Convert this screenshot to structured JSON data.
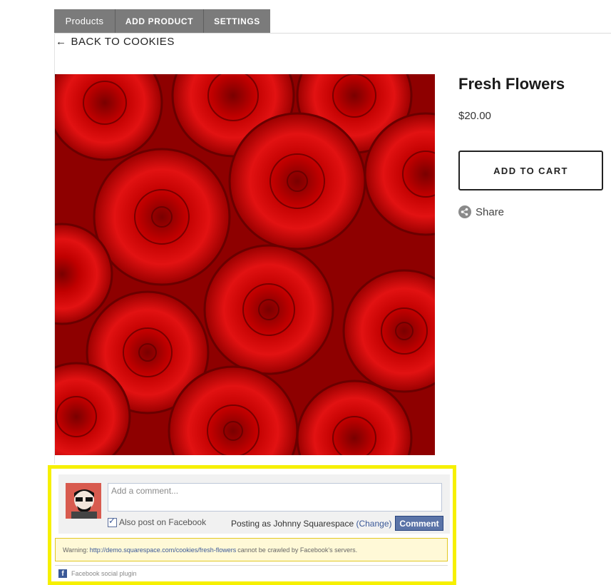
{
  "admin_tabs": [
    "Products",
    "ADD PRODUCT",
    "SETTINGS"
  ],
  "back_link": {
    "arrow": "←",
    "label": "BACK TO COOKIES"
  },
  "product": {
    "title": "Fresh Flowers",
    "price": "$20.00",
    "add_to_cart": "ADD TO CART",
    "share": "Share",
    "image_desc_color": "#c40000"
  },
  "facebook": {
    "placeholder": "Add a comment...",
    "also_post": "Also post on Facebook",
    "posting_as": "Posting as Johnny Squarespace",
    "change": "(Change)",
    "comment_button": "Comment",
    "warning_prefix": "Warning:",
    "warning_url": "http://demo.squarespace.com/cookies/fresh-flowers",
    "warning_suffix": "cannot be crawled by Facebook's servers.",
    "footer": "Facebook social plugin"
  },
  "colors": {
    "highlight": "#f6f000",
    "tab_bg": "#7b7b7b",
    "fb_blue": "#3b5998"
  }
}
